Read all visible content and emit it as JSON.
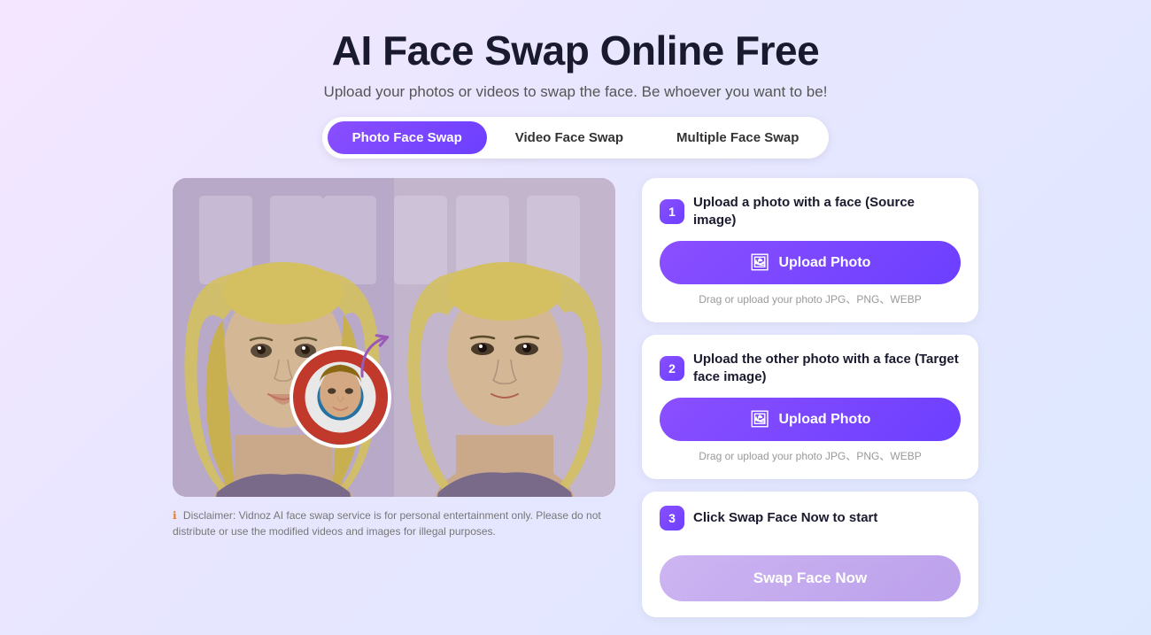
{
  "header": {
    "title": "AI Face Swap Online Free",
    "subtitle": "Upload your photos or videos to swap the face. Be whoever you want to be!"
  },
  "tabs": [
    {
      "id": "photo",
      "label": "Photo Face Swap",
      "active": true
    },
    {
      "id": "video",
      "label": "Video Face Swap",
      "active": false
    },
    {
      "id": "multiple",
      "label": "Multiple Face Swap",
      "active": false
    }
  ],
  "steps": [
    {
      "number": "1",
      "title": "Upload a photo with a face (Source image)",
      "button_label": "Upload Photo",
      "drag_hint": "Drag or upload your photo JPG、PNG、WEBP"
    },
    {
      "number": "2",
      "title": "Upload the other photo with a face (Target face image)",
      "button_label": "Upload Photo",
      "drag_hint": "Drag or upload your photo JPG、PNG、WEBP"
    },
    {
      "number": "3",
      "title": "Click Swap Face Now to start",
      "button_label": "Swap Face Now"
    }
  ],
  "disclaimer": {
    "icon": "ℹ",
    "text": "Disclaimer: Vidnoz AI face swap service is for personal entertainment only. Please do not distribute or use the modified videos and images for illegal purposes."
  },
  "colors": {
    "primary": "#8a4fff",
    "primary_dark": "#6c3fff",
    "swap_btn": "#c4a8f0"
  }
}
